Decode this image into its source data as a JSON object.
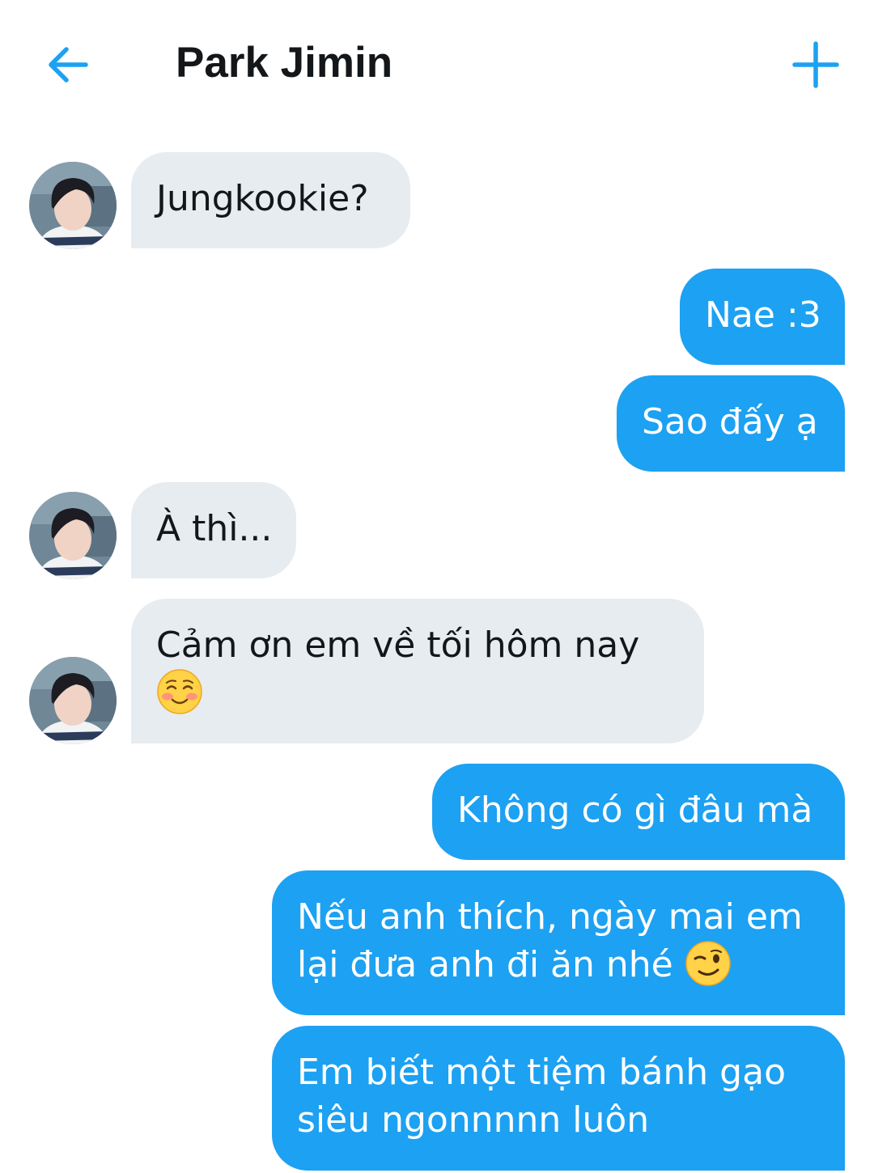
{
  "header": {
    "title": "Park Jimin",
    "back_icon": "back-arrow-icon",
    "add_icon": "plus-icon"
  },
  "colors": {
    "accent": "#1da1f2",
    "incoming_bubble": "#e6ecf0",
    "incoming_text": "#14171a",
    "outgoing_text": "#ffffff"
  },
  "messages": [
    {
      "direction": "incoming",
      "lines": [
        "Jungkookie?"
      ]
    },
    {
      "direction": "outgoing",
      "lines": [
        "Nae :3"
      ]
    },
    {
      "direction": "outgoing",
      "lines": [
        "Sao đấy ạ"
      ]
    },
    {
      "direction": "incoming",
      "lines": [
        "À thì..."
      ]
    },
    {
      "direction": "incoming",
      "lines": [
        "Cảm ơn em về tối hôm nay"
      ],
      "emoji": "smiling-blush-emoji"
    },
    {
      "direction": "outgoing",
      "lines": [
        "Không có gì đâu mà"
      ]
    },
    {
      "direction": "outgoing",
      "lines": [
        "Nếu anh thích, ngày mai em",
        "lại đưa anh đi ăn nhé"
      ],
      "emoji": "winking-face-emoji"
    },
    {
      "direction": "outgoing",
      "lines": [
        "Em biết một tiệm bánh gạo",
        "siêu ngonnnnn luôn"
      ]
    }
  ]
}
